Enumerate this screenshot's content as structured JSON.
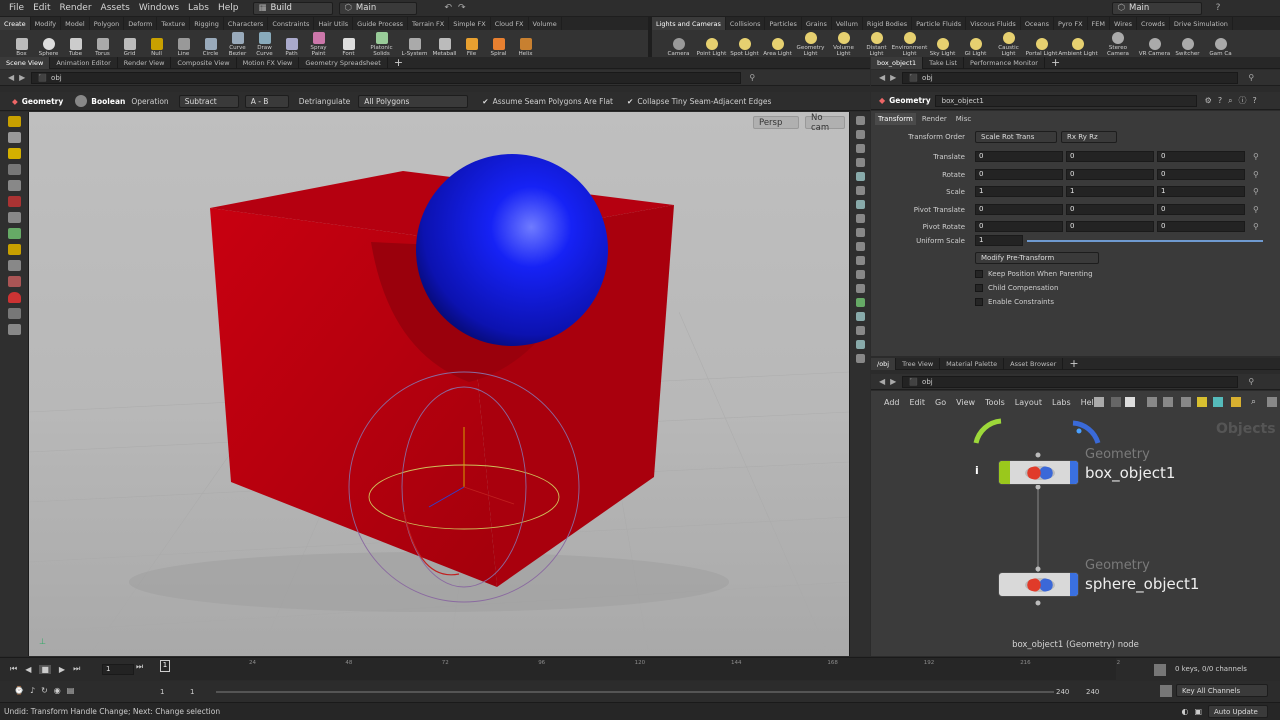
{
  "menu": {
    "items": [
      "File",
      "Edit",
      "Render",
      "Assets",
      "Windows",
      "Labs",
      "Help"
    ],
    "desktop": "Build",
    "workspace": "Main",
    "right_desktop": "Main"
  },
  "shelf_tabs_left": [
    "Create",
    "Modify",
    "Model",
    "Polygon",
    "Deform",
    "Texture",
    "Rigging",
    "Characters",
    "Constraints",
    "Hair Utils",
    "Guide Process",
    "Terrain FX",
    "Simple FX",
    "Cloud FX",
    "Volume"
  ],
  "shelf_tabs_right": [
    "Lights and Cameras",
    "Collisions",
    "Particles",
    "Grains",
    "Vellum",
    "Rigid Bodies",
    "Particle Fluids",
    "Viscous Fluids",
    "Oceans",
    "Pyro FX",
    "FEM",
    "Wires",
    "Crowds",
    "Drive Simulation"
  ],
  "tools_left": [
    "Box",
    "Sphere",
    "Tube",
    "Torus",
    "Grid",
    "Null",
    "Line",
    "Circle",
    "Curve Bezier",
    "Draw Curve",
    "Path",
    "Spray Paint",
    "Font",
    "Platonic Solids",
    "L-System",
    "Metaball",
    "File",
    "Spiral",
    "Helix"
  ],
  "tools_right": [
    "Camera",
    "Point Light",
    "Spot Light",
    "Area Light",
    "Geometry Light",
    "Volume Light",
    "Distant Light",
    "Environment Light",
    "Sky Light",
    "GI Light",
    "Caustic Light",
    "Portal Light",
    "Ambient Light",
    "Stereo Camera",
    "VR Camera",
    "Switcher",
    "Gam Ca"
  ],
  "left_pane_tabs": [
    "Scene View",
    "Animation Editor",
    "Render View",
    "Composite View",
    "Motion FX View",
    "Geometry Spreadsheet"
  ],
  "right_pane_tabs": [
    "box_object1",
    "Take List",
    "Performance Monitor"
  ],
  "net_pane_tabs": [
    "/obj",
    "Tree View",
    "Material Palette",
    "Asset Browser"
  ],
  "path_left": "obj",
  "path_right": "obj",
  "path_net": "obj",
  "viewport_toolbar": {
    "context": "Geometry",
    "op": "Boolean",
    "op_label": "Operation",
    "operation": "Subtract",
    "ab": "A - B",
    "detri": "Detriangulate",
    "polys": "All Polygons",
    "seam_flat": "Assume Seam Polygons Are Flat",
    "collapse": "Collapse Tiny Seam-Adjacent Edges"
  },
  "viewport": {
    "persp": "Persp",
    "cam": "No cam"
  },
  "params": {
    "type": "Geometry",
    "name": "box_object1",
    "tabs": [
      "Transform",
      "Render",
      "Misc"
    ],
    "transform_order_label": "Transform Order",
    "transform_order": "Scale Rot Trans",
    "rot_order": "Rx Ry Rz",
    "rows": [
      {
        "label": "Translate",
        "v": [
          "0",
          "0",
          "0"
        ]
      },
      {
        "label": "Rotate",
        "v": [
          "0",
          "0",
          "0"
        ]
      },
      {
        "label": "Scale",
        "v": [
          "1",
          "1",
          "1"
        ]
      },
      {
        "label": "Pivot Translate",
        "v": [
          "0",
          "0",
          "0"
        ]
      },
      {
        "label": "Pivot Rotate",
        "v": [
          "0",
          "0",
          "0"
        ]
      }
    ],
    "uniform_scale_label": "Uniform Scale",
    "uniform_scale": "1",
    "modify": "Modify Pre-Transform",
    "checks": [
      "Keep Position When Parenting",
      "Child Compensation",
      "Enable Constraints"
    ]
  },
  "network": {
    "menu": [
      "Add",
      "Edit",
      "Go",
      "View",
      "Tools",
      "Layout",
      "Labs",
      "Help"
    ],
    "context_label": "Objects",
    "node1": {
      "type": "Geometry",
      "name": "box_object1"
    },
    "node2": {
      "type": "Geometry",
      "name": "sphere_object1"
    },
    "info_glyph": "i",
    "status": "box_object1 (Geometry) node"
  },
  "timeline": {
    "frame": "1",
    "ticks": [
      "24",
      "48",
      "72",
      "96",
      "120",
      "144",
      "168",
      "192",
      "216",
      "2"
    ],
    "start": "1",
    "start2": "1",
    "end": "240",
    "end2": "240",
    "keys": "0 keys, 0/0 channels",
    "key_channels": "Key All Channels"
  },
  "status": {
    "text": "Undid: Transform Handle Change; Next: Change selection",
    "auto_update": "Auto Update"
  },
  "colors": {
    "box": "#c8000a",
    "sphere": "#1010e0",
    "accent": "#f0a000"
  }
}
